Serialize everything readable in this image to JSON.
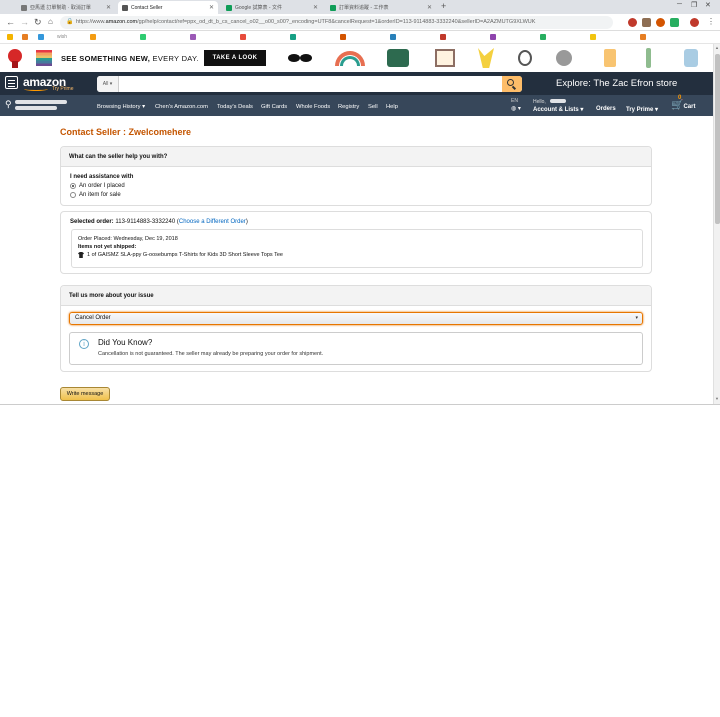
{
  "browser": {
    "tabs": [
      {
        "title": "亞馬遜 訂單幫助 · 取消訂單",
        "active": false,
        "favicon_color": "#777777"
      },
      {
        "title": "Contact Seller",
        "active": true,
        "favicon_color": "#555555"
      },
      {
        "title": "Google 試算表 - 文件",
        "active": false,
        "favicon_color": "#0f9d58"
      },
      {
        "title": "訂單資料追蹤 - 工作表",
        "active": false,
        "favicon_color": "#0f9d58"
      }
    ],
    "new_tab_glyph": "+",
    "url_prefix": "https://www.",
    "url_domain": "amazon.com",
    "url_rest": "/gp/help/contact/ref=ppx_od_dt_b_cs_cancel_o02__o00_s00?_encoding=UTF8&cancelRequest=1&orderID=113-9114883-3332240&sellerID=A2AZMUTG9XLWUK",
    "bookmark_label": "wish"
  },
  "promo": {
    "text_bold": "SEE SOMETHING NEW,",
    "text_normal": " EVERY DAY.",
    "button_label": "TAKE A LOOK"
  },
  "header": {
    "logo": "amazon",
    "logo_sub": "Try Prime",
    "search_dept": "All",
    "search_placeholder": "",
    "store_promo": "Explore: The Zac Efron store"
  },
  "subnav": {
    "links": [
      "Browsing History",
      "Chen's Amazon.com",
      "Today's Deals",
      "Gift Cards",
      "Whole Foods",
      "Registry",
      "Sell",
      "Help"
    ],
    "lang": "EN",
    "hello": "Hello,",
    "account": "Account & Lists",
    "orders": "Orders",
    "prime": "Try Prime",
    "cart_count": "0",
    "cart": "Cart"
  },
  "page": {
    "title": "Contact Seller : Zwelcomehere",
    "section1": {
      "header": "What can the seller help you with?",
      "label": "I need assistance with",
      "options": [
        "An order I placed",
        "An item for sale"
      ],
      "selected_index": 0
    },
    "order": {
      "label": "Selected order:",
      "order_id": "113-9114883-3332240",
      "change_link": "Choose a Different Order",
      "placed": "Order Placed: Wednesday, Dec 19, 2018",
      "shipped_label": "Items not yet shipped:",
      "item": "1 of GAISMZ SLA-ppy G-oosebumps T-Shirts for Kids 3D Short Sleeve Tops Tee"
    },
    "section2": {
      "header": "Tell us more about your issue",
      "select_value": "Cancel Order",
      "tip_title": "Did You Know?",
      "tip_body": "Cancellation is not guaranteed. The seller may already be preparing your order for shipment."
    },
    "write_button": "Write message"
  },
  "colors": {
    "nav_dark": "#232f3e",
    "nav_light": "#37475a",
    "accent_orange": "#c45500",
    "search_button": "#febd69",
    "link": "#0066c0"
  }
}
